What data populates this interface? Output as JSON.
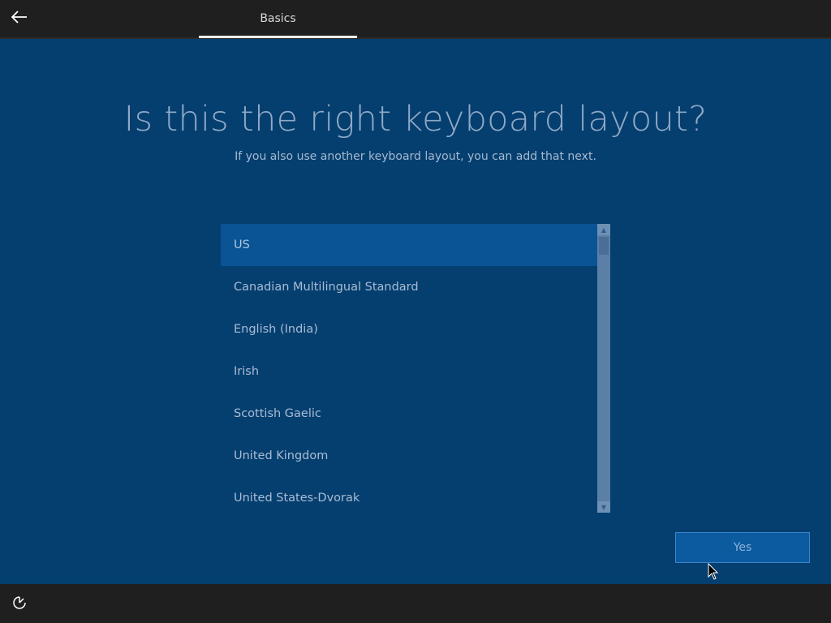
{
  "header": {
    "back_icon": "back-arrow-icon",
    "tab_label": "Basics"
  },
  "main": {
    "title": "Is this the right keyboard layout?",
    "subtitle": "If you also use another keyboard layout, you can add that next."
  },
  "layouts": {
    "items": [
      "US",
      "Canadian Multilingual Standard",
      "English (India)",
      "Irish",
      "Scottish Gaelic",
      "United Kingdom",
      "United States-Dvorak"
    ],
    "selected": "US"
  },
  "actions": {
    "yes_label": "Yes"
  },
  "footer": {
    "ease_of_access_icon": "ease-of-access-icon"
  },
  "colors": {
    "background": "#053f70",
    "selection": "#0a5496",
    "bars": "#1f1f1f",
    "button": "#0c5aa0"
  }
}
